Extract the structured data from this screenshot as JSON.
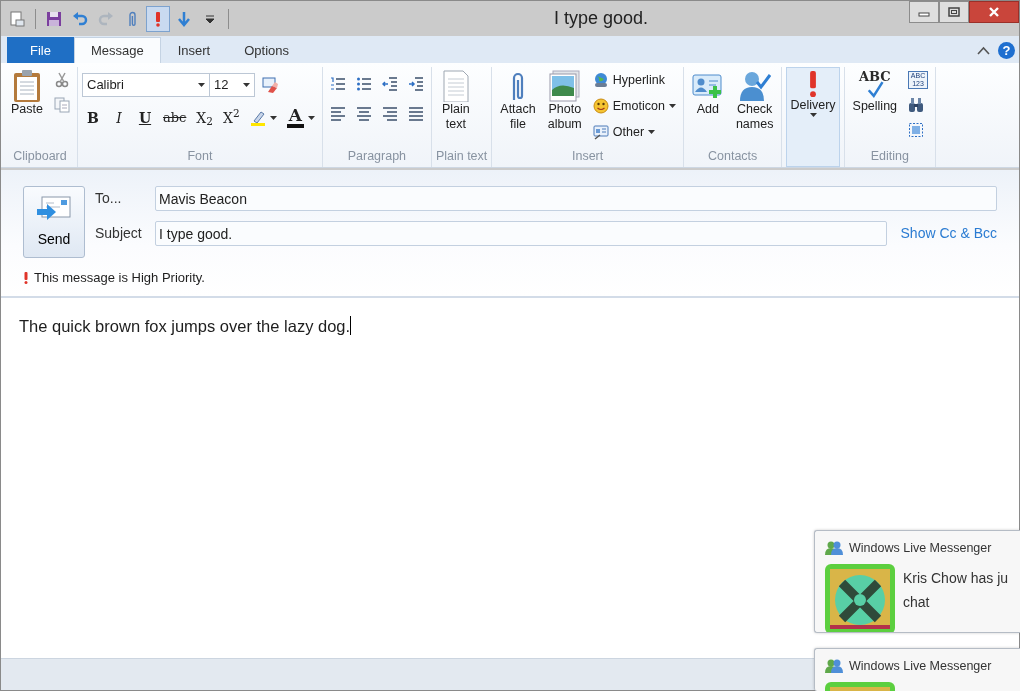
{
  "window": {
    "title": "I type good."
  },
  "quick_access": [
    {
      "selected": false,
      "disabled": false
    },
    {
      "selected": false,
      "disabled": false
    },
    {
      "selected": false,
      "disabled": false
    },
    {
      "selected": false,
      "disabled": true
    },
    {
      "selected": false,
      "disabled": false
    },
    {
      "selected": true,
      "disabled": false
    },
    {
      "selected": false,
      "disabled": false
    },
    {
      "selected": false,
      "disabled": false
    }
  ],
  "tabs": [
    {
      "label": "File",
      "kind": "file",
      "selected": false
    },
    {
      "label": "Message",
      "kind": "tab",
      "selected": true
    },
    {
      "label": "Insert",
      "kind": "tab",
      "selected": false
    },
    {
      "label": "Options",
      "kind": "tab",
      "selected": false
    }
  ],
  "help_glyph": "?",
  "ribbon": {
    "groups": [
      {
        "label": "Clipboard",
        "items": [
          {
            "kind": "large",
            "label": "Paste"
          },
          {
            "kind": "stack",
            "items": [
              {
                "kind": "icon"
              },
              {
                "kind": "icon"
              }
            ]
          }
        ]
      },
      {
        "label": "Font",
        "items": [
          {
            "kind": "rows",
            "top": [
              {
                "kind": "font_combo",
                "value": "Calibri"
              },
              {
                "kind": "size_combo",
                "value": "12"
              },
              {
                "kind": "icon"
              }
            ],
            "bottom": [
              {
                "kind": "bold",
                "glyph": "B"
              },
              {
                "kind": "italic",
                "glyph": "I"
              },
              {
                "kind": "underline",
                "glyph": "U"
              },
              {
                "kind": "strike",
                "glyph": "abc"
              },
              {
                "kind": "script",
                "glyph": "X$_{2}$"
              },
              {
                "kind": "script",
                "glyph": "X$^{2}$"
              },
              {
                "kind": "icon",
                "dropdown": true
              },
              {
                "kind": "color",
                "glyph": "A",
                "dropdown": true
              }
            ]
          }
        ]
      },
      {
        "label": "Paragraph",
        "items": [
          {
            "kind": "rows",
            "top": [
              {
                "kind": "icon"
              },
              {
                "kind": "icon"
              },
              {
                "kind": "icon"
              },
              {
                "kind": "icon"
              }
            ],
            "bottom": [
              {
                "kind": "icon"
              },
              {
                "kind": "icon"
              },
              {
                "kind": "icon"
              },
              {
                "kind": "icon"
              }
            ]
          }
        ]
      },
      {
        "label": "Plain text",
        "items": [
          {
            "kind": "large",
            "label": "Plain text"
          }
        ]
      },
      {
        "label": "Insert",
        "items": [
          {
            "kind": "large",
            "label": "Attach file"
          },
          {
            "kind": "large",
            "label": "Photo album"
          },
          {
            "kind": "stack",
            "items": [
              {
                "kind": "labeled",
                "label": "Hyperlink"
              },
              {
                "kind": "labeled",
                "label": "Emoticon",
                "dropdown": true
              },
              {
                "kind": "labeled",
                "label": "Other",
                "dropdown": true
              }
            ]
          }
        ]
      },
      {
        "label": "Contacts",
        "items": [
          {
            "kind": "large",
            "label": "Add"
          },
          {
            "kind": "large",
            "label": "Check names"
          }
        ]
      },
      {
        "items": [
          {
            "kind": "large",
            "label": "Delivery",
            "dropdown": true,
            "selected": true
          }
        ]
      },
      {
        "label": "Editing",
        "items": [
          {
            "kind": "large",
            "label": "Spelling",
            "glyph": "ABC"
          },
          {
            "kind": "stack",
            "items": [
              {
                "kind": "tiny",
                "glyph": "ABC 123"
              },
              {
                "kind": "icon"
              },
              {
                "kind": "icon"
              }
            ]
          }
        ]
      }
    ]
  },
  "compose": {
    "send_label": "Send",
    "to_label": "To...",
    "to_value": "Mavis Beacon",
    "subject_label": "Subject",
    "subject_value": "I type good.",
    "cc_link": "Show Cc & Bcc",
    "priority_notice": "This message is High Priority."
  },
  "body": {
    "text": "The quick brown fox jumps over the lazy dog."
  },
  "notifications": [
    {
      "app": "Windows Live Messenger",
      "message_lines": [
        "Kris Chow has ju",
        "chat"
      ]
    },
    {
      "app": "Windows Live Messenger"
    }
  ]
}
